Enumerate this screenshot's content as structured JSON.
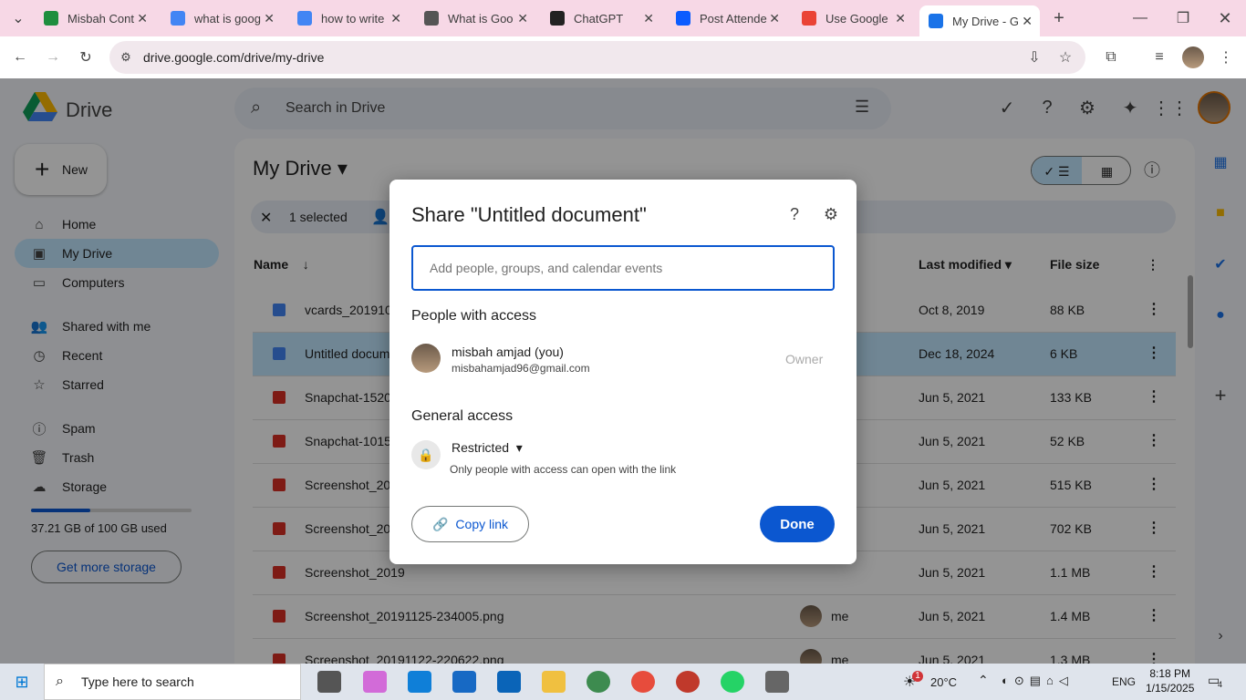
{
  "browser": {
    "tabs": [
      {
        "title": "Misbah Cont",
        "color": "#1e8e3e"
      },
      {
        "title": "what is goog",
        "color": "#4285f4"
      },
      {
        "title": "how to write",
        "color": "#4285f4"
      },
      {
        "title": "What is Goo",
        "color": "#555555"
      },
      {
        "title": "ChatGPT",
        "color": "#222222"
      },
      {
        "title": "Post Attende",
        "color": "#0b5cff"
      },
      {
        "title": "Use Google",
        "color": "#ea4335"
      },
      {
        "title": "My Drive - G",
        "color": "#1a73e8"
      }
    ],
    "url": "drive.google.com/drive/my-drive",
    "new_tab": "+"
  },
  "drive": {
    "logo": "Drive",
    "search_placeholder": "Search in Drive",
    "new_label": "New",
    "nav": [
      {
        "label": "Home",
        "icon": "⌂"
      },
      {
        "label": "My Drive",
        "icon": "▣"
      },
      {
        "label": "Computers",
        "icon": "▭"
      },
      {
        "label": "Shared with me",
        "icon": "👥"
      },
      {
        "label": "Recent",
        "icon": "◷"
      },
      {
        "label": "Starred",
        "icon": "☆"
      },
      {
        "label": "Spam",
        "icon": "ⓘ"
      },
      {
        "label": "Trash",
        "icon": "🗑"
      },
      {
        "label": "Storage",
        "icon": "☁"
      }
    ],
    "storage_used": "37.21 GB of 100 GB used",
    "storage_fraction": 0.37,
    "get_storage": "Get more storage",
    "title": "My Drive",
    "selected_count": "1 selected",
    "columns": {
      "name": "Name",
      "modified": "Last modified",
      "size": "File size"
    },
    "rows": [
      {
        "name": "vcards_20191003",
        "owner": "",
        "modified": "Oct 8, 2019",
        "size": "88 KB",
        "type": "doc"
      },
      {
        "name": "Untitled document",
        "owner": "",
        "modified": "Dec 18, 2024",
        "size": "6 KB",
        "type": "doc"
      },
      {
        "name": "Snapchat-1520",
        "owner": "",
        "modified": "Jun 5, 2021",
        "size": "133 KB",
        "type": "img"
      },
      {
        "name": "Snapchat-1015",
        "owner": "",
        "modified": "Jun 5, 2021",
        "size": "52 KB",
        "type": "img"
      },
      {
        "name": "Screenshot_2019",
        "owner": "",
        "modified": "Jun 5, 2021",
        "size": "515 KB",
        "type": "img"
      },
      {
        "name": "Screenshot_2019",
        "owner": "",
        "modified": "Jun 5, 2021",
        "size": "702 KB",
        "type": "img"
      },
      {
        "name": "Screenshot_2019",
        "owner": "",
        "modified": "Jun 5, 2021",
        "size": "1.1 MB",
        "type": "img"
      },
      {
        "name": "Screenshot_20191125-234005.png",
        "owner": "me",
        "modified": "Jun 5, 2021",
        "size": "1.4 MB",
        "type": "img"
      },
      {
        "name": "Screenshot_20191122-220622.png",
        "owner": "me",
        "modified": "Jun 5, 2021",
        "size": "1.3 MB",
        "type": "img"
      }
    ]
  },
  "dialog": {
    "title": "Share \"Untitled document\"",
    "input_placeholder": "Add people, groups, and calendar events",
    "people_heading": "People with access",
    "person_name": "misbah amjad (you)",
    "person_email": "misbahamjad96@gmail.com",
    "person_role": "Owner",
    "general_heading": "General access",
    "access_level": "Restricted",
    "access_desc": "Only people with access can open with the link",
    "copy_link": "Copy link",
    "done": "Done"
  },
  "taskbar": {
    "search_placeholder": "Type here to search",
    "weather": "20°C",
    "weather_badge": "1",
    "language": "ENG",
    "time": "8:18 PM",
    "date": "1/15/2025",
    "notifications": "4"
  }
}
